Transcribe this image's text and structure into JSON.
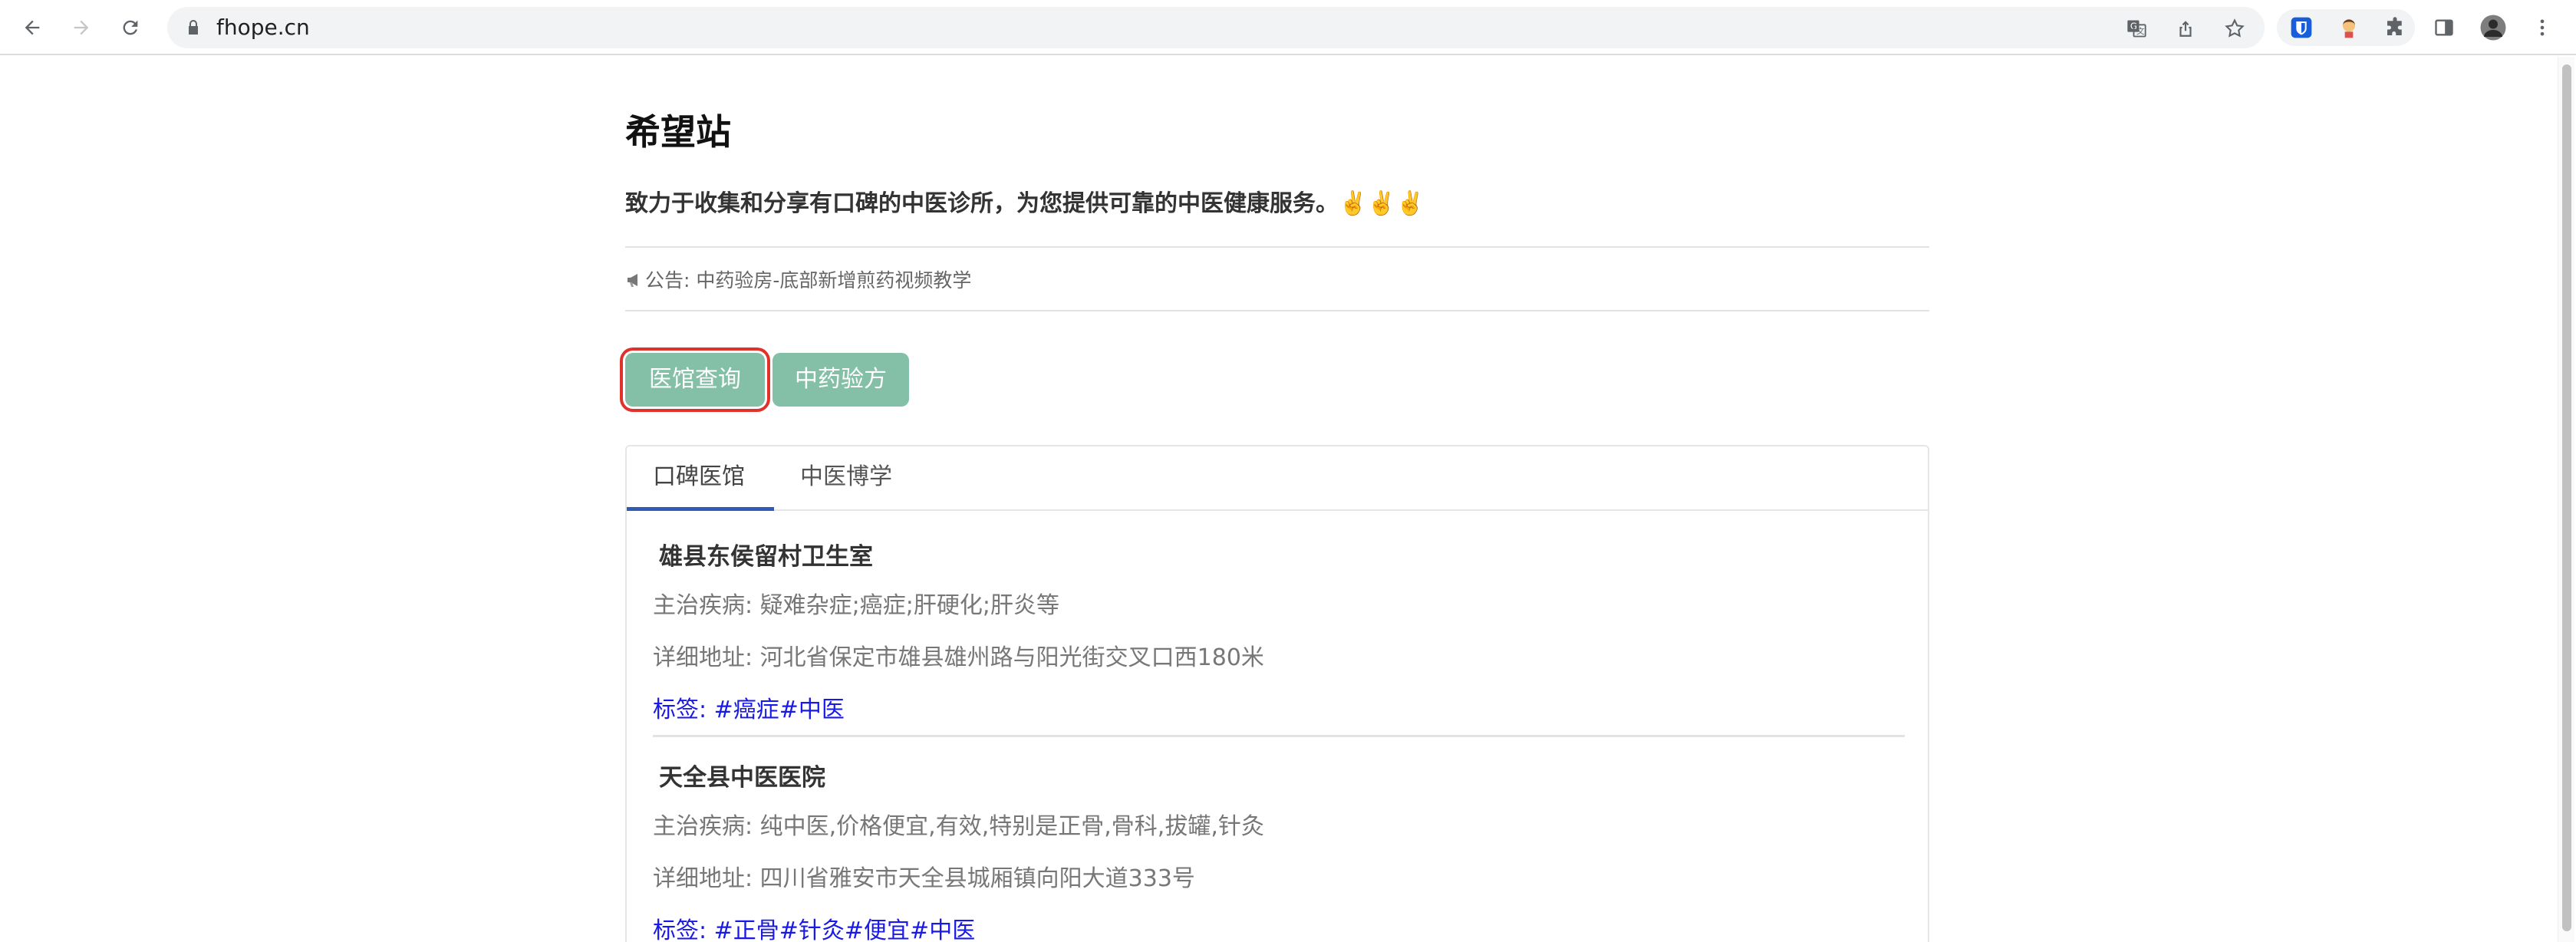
{
  "browser": {
    "url": "fhope.cn"
  },
  "site": {
    "title": "希望站",
    "description": "致力于收集和分享有口碑的中医诊所，为您提供可靠的中医健康服务。✌️✌️✌️",
    "notice": "公告: 中药验房-底部新增煎药视频教学"
  },
  "buttons": {
    "clinic_search": "医馆查询",
    "herbal_prescription": "中药验方"
  },
  "tabs": {
    "items": [
      {
        "label": "口碑医馆",
        "active": true
      },
      {
        "label": "中医博学",
        "active": false
      }
    ]
  },
  "clinics": [
    {
      "name": "雄县东侯留村卫生室",
      "diseases": "主治疾病: 疑难杂症;癌症;肝硬化;肝炎等",
      "address": "详细地址: 河北省保定市雄县雄州路与阳光街交叉口西180米",
      "tags": "标签: #癌症#中医"
    },
    {
      "name": "天全县中医医院",
      "diseases": "主治疾病: 纯中医,价格便宜,有效,特别是正骨,骨科,拔罐,针灸",
      "address": "详细地址: 四川省雅安市天全县城厢镇向阳大道333号",
      "tags": "标签: #正骨#针灸#便宜#中医"
    }
  ],
  "colors": {
    "button_bg": "#84bfa7",
    "tab_active_underline": "#2f5bb7",
    "tag_link": "#1a1ae6",
    "selection_outline": "#e0312b"
  }
}
